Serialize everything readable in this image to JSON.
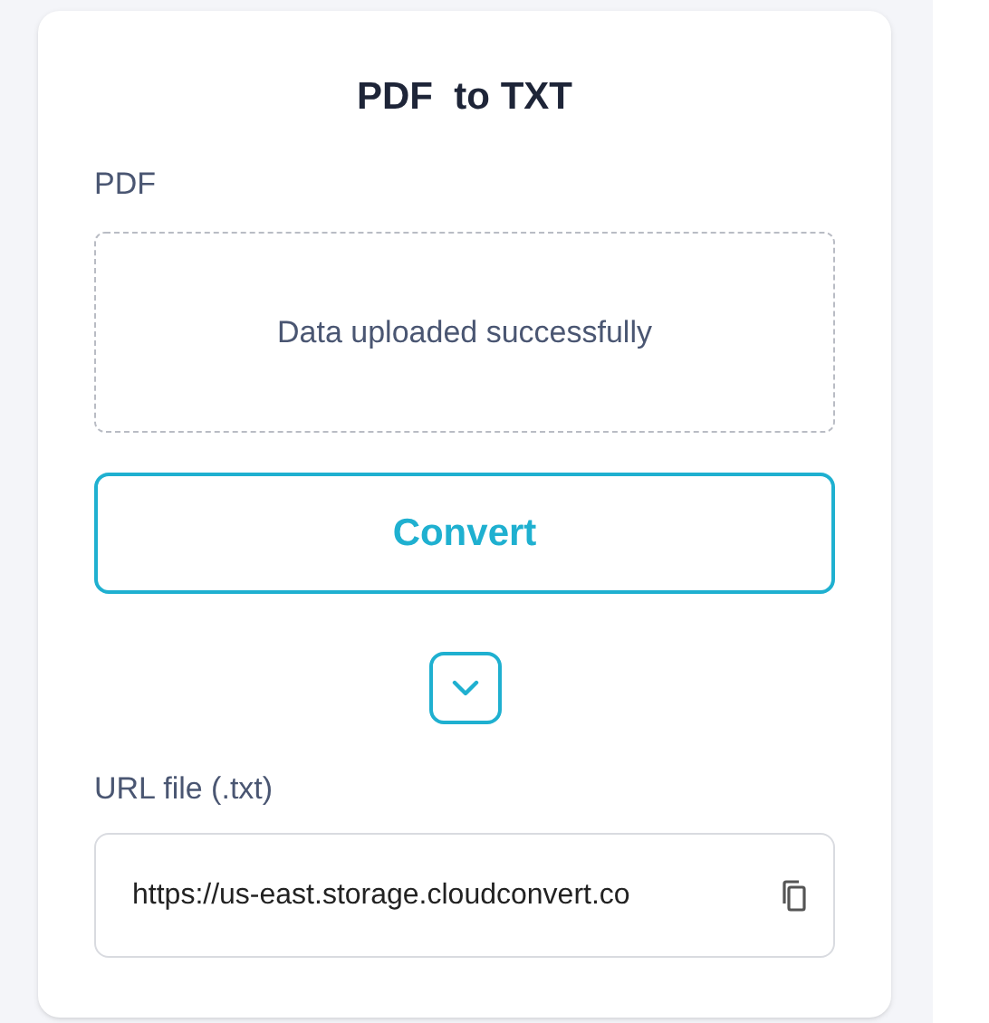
{
  "title": "PDF  to TXT",
  "input_label": "PDF",
  "upload_status": "Data uploaded successfully",
  "convert_button": "Convert",
  "output_label": "URL file (.txt)",
  "output_url": "https://us-east.storage.cloudconvert.co"
}
